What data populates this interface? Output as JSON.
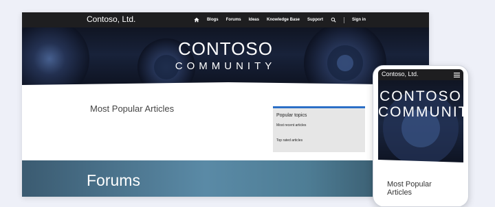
{
  "desktop": {
    "brand": "Contoso, Ltd.",
    "nav": {
      "blogs": "Blogs",
      "forums": "Forums",
      "ideas": "Ideas",
      "knowledge_base": "Knowledge Base",
      "support": "Support",
      "sign_in": "Sign in"
    },
    "hero": {
      "title": "CONTOSO",
      "subtitle": "COMMUNITY"
    },
    "main": {
      "section_title": "Most Popular Articles",
      "popular_topics": {
        "title": "Popular topics",
        "link1": "Most recent articles",
        "link2": "Top rated articles"
      }
    },
    "forums_title": "Forums"
  },
  "mobile": {
    "brand": "Contoso, Ltd.",
    "hero_text": "CONTOSO COMMUNITY",
    "section_title": "Most Popular Articles"
  },
  "colors": {
    "nav_bg": "#1e1e20",
    "accent": "#2b6fc6",
    "page_bg": "#eef0f8"
  },
  "icons": [
    "home-icon",
    "search-icon",
    "hamburger-menu-icon"
  ]
}
